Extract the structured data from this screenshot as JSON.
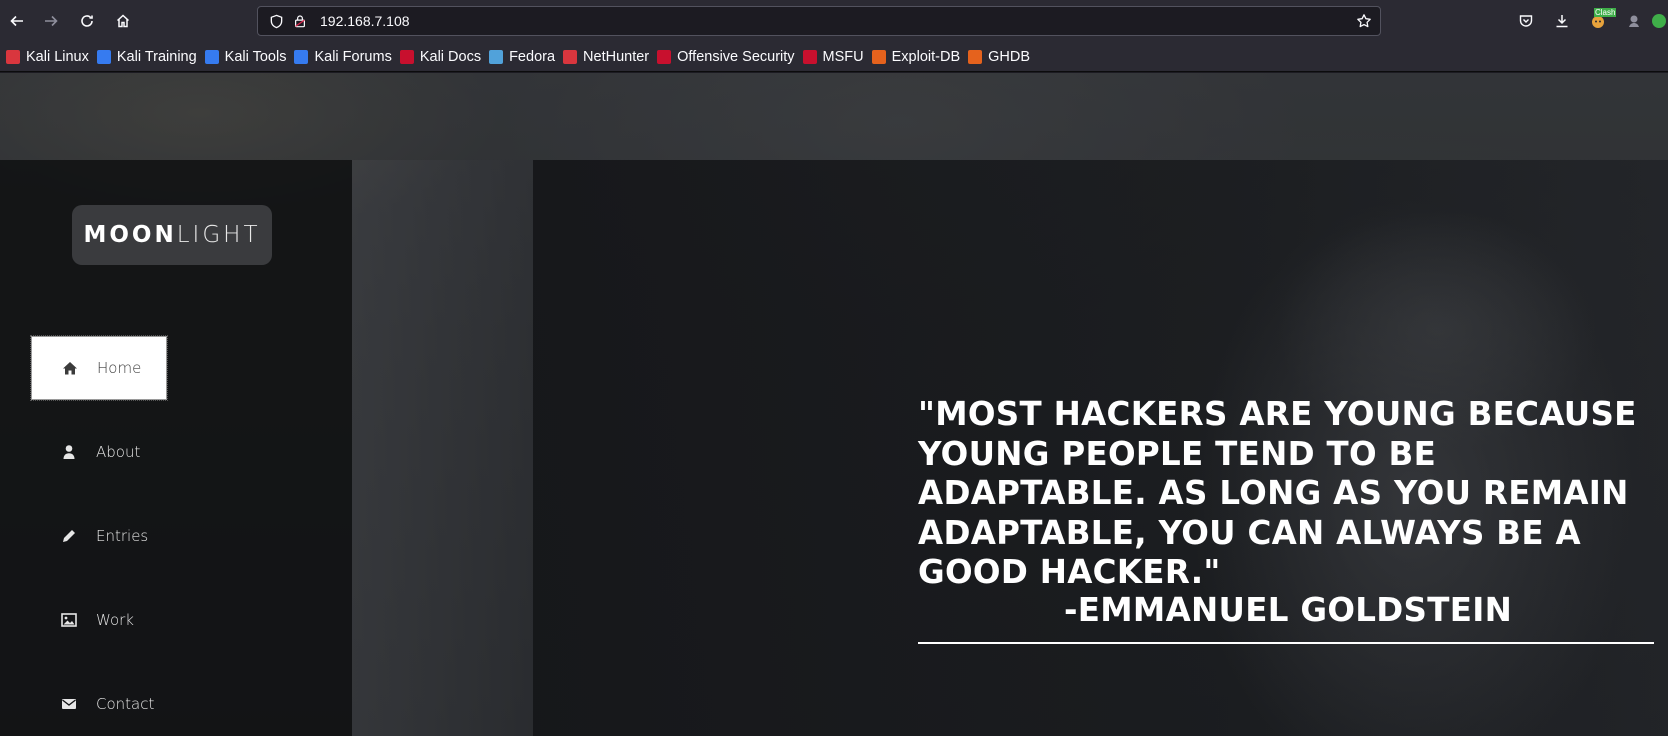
{
  "browser": {
    "url": "192.168.7.108",
    "bookmarks": [
      {
        "label": "Kali Linux",
        "color": "#d9363e"
      },
      {
        "label": "Kali Training",
        "color": "#367bf0"
      },
      {
        "label": "Kali Tools",
        "color": "#367bf0"
      },
      {
        "label": "Kali Forums",
        "color": "#367bf0"
      },
      {
        "label": "Kali Docs",
        "color": "#c8102e"
      },
      {
        "label": "Fedora",
        "color": "#51a2da"
      },
      {
        "label": "NetHunter",
        "color": "#d9363e"
      },
      {
        "label": "Offensive Security",
        "color": "#c8102e"
      },
      {
        "label": "MSFU",
        "color": "#c8102e"
      },
      {
        "label": "Exploit-DB",
        "color": "#e5621d"
      },
      {
        "label": "GHDB",
        "color": "#e5621d"
      }
    ],
    "extension_badge": "Clash"
  },
  "site": {
    "logo_bold": "MOON",
    "logo_light": "LIGHT",
    "menu": [
      {
        "label": "Home",
        "icon": "home-icon",
        "active": true
      },
      {
        "label": "About",
        "icon": "user-icon",
        "active": false
      },
      {
        "label": "Entries",
        "icon": "pencil-icon",
        "active": false
      },
      {
        "label": "Work",
        "icon": "image-icon",
        "active": false
      },
      {
        "label": "Contact",
        "icon": "envelope-icon",
        "active": false
      }
    ],
    "quote_lines": [
      "\"MOST HACKERS ARE YOUNG BECAUSE",
      "YOUNG PEOPLE TEND TO BE",
      "ADAPTABLE. AS LONG AS YOU REMAIN",
      "ADAPTABLE, YOU CAN ALWAYS BE A",
      "GOOD HACKER.\""
    ],
    "quote_author": "-EMMANUEL GOLDSTEIN"
  }
}
